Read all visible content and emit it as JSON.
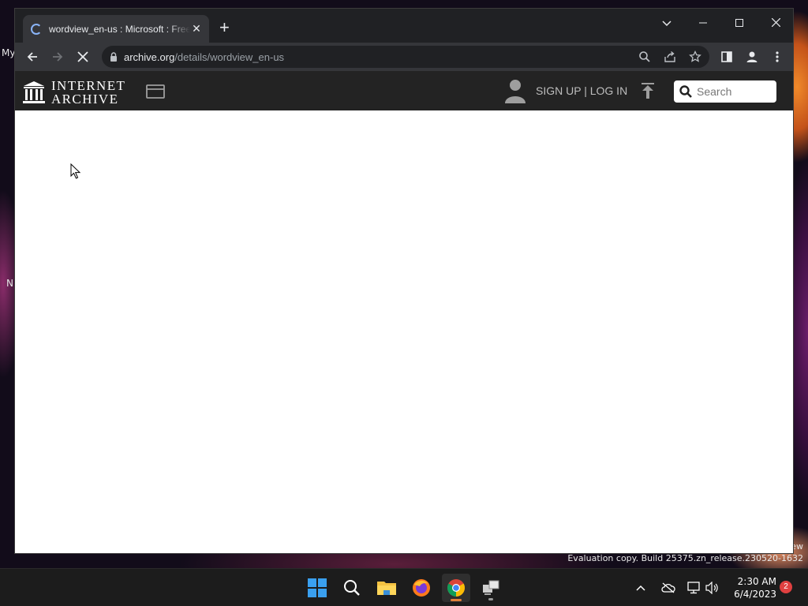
{
  "browser": {
    "tab_title": "wordview_en-us : Microsoft : Free Download, Borrow, and Streaming : Internet Archive",
    "address_host": "archive.org",
    "address_path": "/details/wordview_en-us"
  },
  "site": {
    "logo_line1": "INTERNET",
    "logo_line2": "ARCHIVE",
    "signup_login": "SIGN UP | LOG IN",
    "search_placeholder": "Search"
  },
  "desktop": {
    "label_top": "My",
    "label_mid": "N",
    "watermark_line1": "ew",
    "watermark_line2": "Evaluation copy. Build 25375.zn_release.230520-1632"
  },
  "taskbar": {
    "apps": [
      "start",
      "search",
      "file-explorer",
      "firefox",
      "chrome",
      "network-app"
    ],
    "time": "2:30 AM",
    "date": "6/4/2023",
    "notification_count": "2"
  },
  "colors": {
    "ia_header": "#232323",
    "chrome_dark": "#202124",
    "chrome_toolbar": "#35363a",
    "accent_blue": "#8ab4f8"
  }
}
